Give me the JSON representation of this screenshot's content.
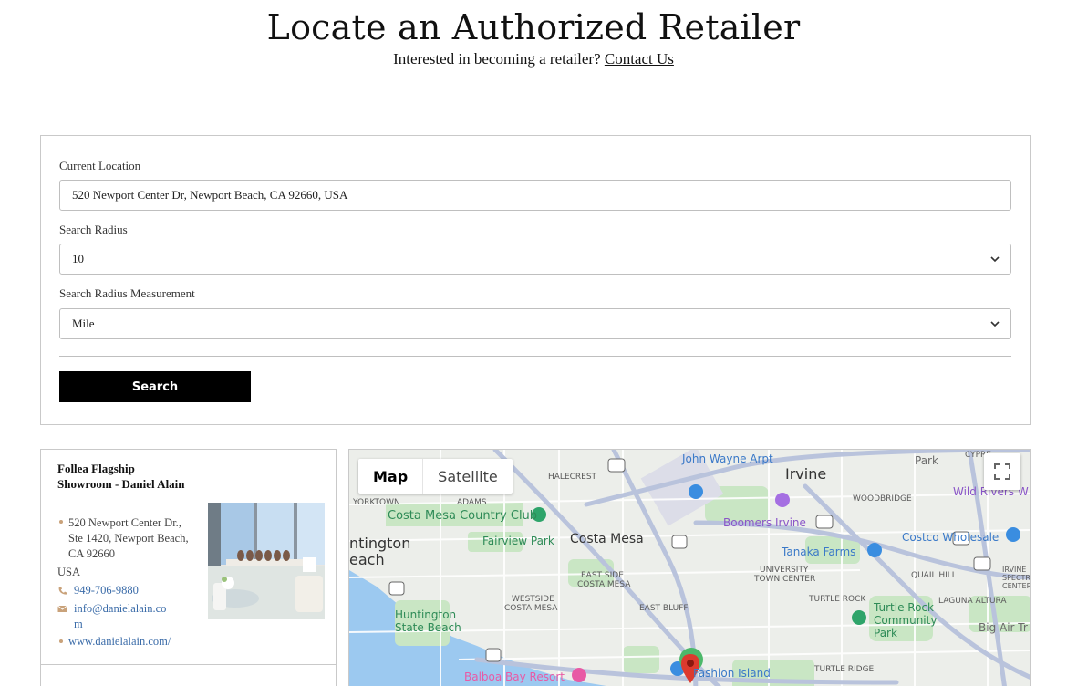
{
  "header": {
    "title": "Locate an Authorized Retailer",
    "subtitle": "Interested in becoming a retailer?",
    "contact_link": "Contact Us"
  },
  "search_form": {
    "location_label": "Current Location",
    "location_value": "520 Newport Center Dr, Newport Beach, CA 92660, USA",
    "radius_label": "Search Radius",
    "radius_value": "10",
    "measurement_label": "Search Radius Measurement",
    "measurement_value": "Mile",
    "search_button": "Search"
  },
  "results": [
    {
      "name": "Follea Flagship Showroom - Daniel Alain",
      "address_line1": "520 Newport Center Dr., Ste 1420, Newport Beach, CA 92660",
      "country": "USA",
      "phone": "949-706-9880",
      "email": "info@danielalain.com",
      "email_line1": "info@danielalain.co",
      "email_line2": "m",
      "website": "www.danielalain.com/"
    }
  ],
  "map": {
    "map_button": "Map",
    "satellite_button": "Satellite",
    "labels": {
      "irvine": "Irvine",
      "halecrest": "HALECREST",
      "john_wayne": "John Wayne Arpt",
      "park": "Park",
      "cypress": "CYPRE",
      "yorktown": "YORKTOWN",
      "adams": "ADAMS",
      "costa_mesa_cc": "Costa Mesa Country Club",
      "costa_mesa": "Costa Mesa",
      "fairview": "Fairview Park",
      "huntington1": "ntington",
      "huntington2": "each",
      "east_side1": "EAST SIDE",
      "east_side2": "COSTA MESA",
      "westside1": "WESTSIDE",
      "westside2": "COSTA MESA",
      "boomers": "Boomers Irvine",
      "woodbridge": "WOODBRIDGE",
      "wild_rivers": "Wild Rivers W",
      "tanaka": "Tanaka Farms",
      "costco": "Costco Wholesale",
      "university1": "UNIVERSITY",
      "university2": "TOWN CENTER",
      "quail": "QUAIL HILL",
      "irvine_spectrum1": "IRVINE",
      "irvine_spectrum2": "SPECTRUM",
      "irvine_spectrum3": "CENTER",
      "turtle_rock": "TURTLE ROCK",
      "laguna_altura": "LAGUNA ALTURA",
      "turtle_rock_park1": "Turtle Rock",
      "turtle_rock_park2": "Community",
      "turtle_rock_park3": "Park",
      "east_bluff": "EAST BLUFF",
      "huntington_sb1": "Huntington",
      "huntington_sb2": "State Beach",
      "big_air": "Big Air Tr",
      "balboa": "Balboa Bay Resort",
      "fashion_island": "Fashion Island",
      "turtle_ridge": "TURTLE RIDGE"
    }
  }
}
